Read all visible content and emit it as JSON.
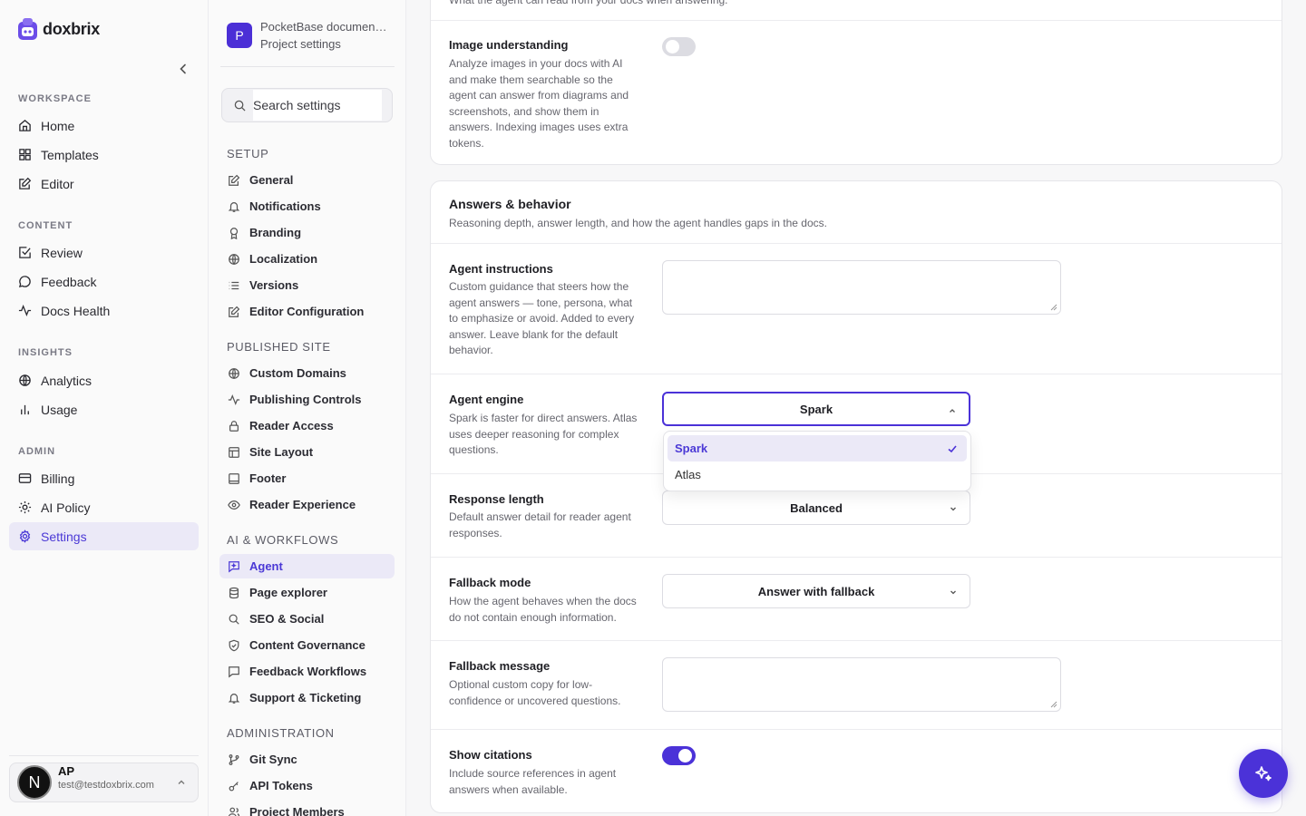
{
  "brand": {
    "name": "doxbrix"
  },
  "nav": {
    "sections": {
      "workspace": "WORKSPACE",
      "content": "CONTENT",
      "insights": "INSIGHTS",
      "admin": "ADMIN"
    },
    "items": {
      "home": "Home",
      "templates": "Templates",
      "editor": "Editor",
      "review": "Review",
      "feedback": "Feedback",
      "docs_health": "Docs Health",
      "analytics": "Analytics",
      "usage": "Usage",
      "billing": "Billing",
      "ai_policy": "AI Policy",
      "settings": "Settings"
    },
    "active": "settings"
  },
  "user": {
    "initials_avatar": "N",
    "name": "AP",
    "email": "test@testdoxbrix.com"
  },
  "project": {
    "name": "PocketBase documen…",
    "subtitle": "Project settings",
    "badge": "P"
  },
  "settings_nav": {
    "search_placeholder": "Search settings",
    "sections": {
      "setup": "SETUP",
      "published": "PUBLISHED SITE",
      "ai": "AI & WORKFLOWS",
      "admin": "ADMINISTRATION"
    },
    "items": {
      "general": "General",
      "notifications": "Notifications",
      "branding": "Branding",
      "localization": "Localization",
      "versions": "Versions",
      "editor_config": "Editor Configuration",
      "custom_domains": "Custom Domains",
      "publishing": "Publishing Controls",
      "reader_access": "Reader Access",
      "site_layout": "Site Layout",
      "footer": "Footer",
      "reader_exp": "Reader Experience",
      "agent": "Agent",
      "page_explorer": "Page explorer",
      "seo": "SEO & Social",
      "governance": "Content Governance",
      "feedback_wf": "Feedback Workflows",
      "support": "Support & Ticketing",
      "git_sync": "Git Sync",
      "api_tokens": "API Tokens",
      "members": "Project Members"
    },
    "active": "agent"
  },
  "content": {
    "top_cut_text": "What the agent can read from your docs when answering.",
    "image_understanding": {
      "title": "Image understanding",
      "desc": "Analyze images in your docs with AI and make them searchable so the agent can answer from diagrams and screenshots, and show them in answers. Indexing images uses extra tokens.",
      "enabled": false
    },
    "answers_card": {
      "title": "Answers & behavior",
      "subtitle": "Reasoning depth, answer length, and how the agent handles gaps in the docs."
    },
    "agent_instructions": {
      "title": "Agent instructions",
      "desc": "Custom guidance that steers how the agent answers — tone, persona, what to emphasize or avoid. Added to every answer. Leave blank for the default behavior.",
      "value": ""
    },
    "agent_engine": {
      "title": "Agent engine",
      "desc": "Spark is faster for direct answers. Atlas uses deeper reasoning for complex questions.",
      "value": "Spark",
      "options": [
        "Spark",
        "Atlas"
      ]
    },
    "response_length": {
      "title": "Response length",
      "desc": "Default answer detail for reader agent responses.",
      "value": "Balanced"
    },
    "fallback_mode": {
      "title": "Fallback mode",
      "desc": "How the agent behaves when the docs do not contain enough information.",
      "value": "Answer with fallback"
    },
    "fallback_message": {
      "title": "Fallback message",
      "desc": "Optional custom copy for low-confidence or uncovered questions.",
      "value": ""
    },
    "show_citations": {
      "title": "Show citations",
      "desc": "Include source references in agent answers when available.",
      "enabled": true
    }
  },
  "colors": {
    "accent": "#4b32d8",
    "active_bg": "#ebe9f7"
  },
  "fab": {
    "icon": "sparkles-icon"
  }
}
